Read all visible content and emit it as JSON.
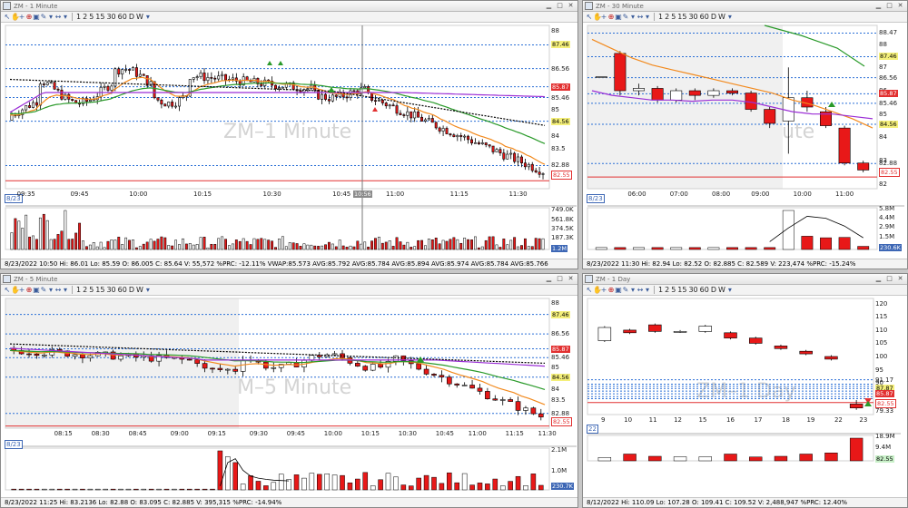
{
  "colors": {
    "up": "#ffffff",
    "down": "#e81818",
    "ema_orange": "#f28a1e",
    "ema_green": "#2a9a2a",
    "vwap_purple": "#9b2fd6",
    "sma_black": "#000000",
    "level_blue": "#2a6fd6",
    "level_red": "#e23030",
    "volume": "#e81818"
  },
  "toolbar": {
    "timeframes": [
      "1",
      "2",
      "5",
      "15",
      "30",
      "60",
      "D",
      "W"
    ],
    "icons": [
      "cursor-icon",
      "hand-icon",
      "crosshair-icon",
      "zoom-icon",
      "pencil-icon",
      "arrows-icon"
    ]
  },
  "panels": [
    {
      "id": "p1",
      "title": "ZM - 1 Minute",
      "watermark": "ZM–1 Minute",
      "date_tag": "8/23",
      "y_labels": [
        "88",
        "87.46",
        "86.56",
        "85.87",
        "85.46",
        "85",
        "84.56",
        "84",
        "83.5",
        "82.88",
        "82.55"
      ],
      "x_labels": [
        "09:35",
        "09:45",
        "10:00",
        "10:15",
        "10:30",
        "10:45",
        "11:00",
        "11:15",
        "11:30"
      ],
      "cursor_time": "10:56",
      "volume_labels": [
        "749.0K",
        "561.8K",
        "374.5K",
        "187.3K",
        "1.2M"
      ],
      "status": "8/23/2022 10:50  Hi: 86.01  Lo: 85.59  O: 86.005  C: 85.64  V: 55,572 %PRC: -12.11% VWAP:85.573 AVG:85.792 AVG:85.784 AVG:85.894 AVG:85.974 AVG:85.784 AVG:85.766"
    },
    {
      "id": "p2",
      "title": "ZM - 30 Minute",
      "watermark": "ZM–30 Minute",
      "date_tag": "8/23",
      "y_labels": [
        "88.47",
        "88",
        "87.46",
        "87",
        "86.56",
        "86",
        "85.87",
        "85.46",
        "85",
        "84.56",
        "84",
        "83",
        "82.88",
        "82.55",
        "82"
      ],
      "x_labels": [
        "06:00",
        "07:00",
        "08:00",
        "09:00",
        "10:00",
        "11:00"
      ],
      "volume_labels": [
        "5.8M",
        "4.4M",
        "2.9M",
        "1.5M",
        "230.6K"
      ],
      "status": "8/23/2022 11:30  Hi: 82.94  Lo: 82.52  O: 82.885  C: 82.589  V: 223,474 %PRC: -15.24%"
    },
    {
      "id": "p3",
      "title": "ZM - 5 Minute",
      "watermark": "ZM–5 Minute",
      "date_tag": "8/23",
      "y_labels": [
        "88",
        "87.46",
        "86.56",
        "85.87",
        "85.46",
        "85",
        "84.56",
        "84",
        "83.5",
        "82.88",
        "82.55"
      ],
      "x_labels": [
        "08:15",
        "08:30",
        "08:45",
        "09:00",
        "09:15",
        "09:30",
        "09:45",
        "10:00",
        "10:15",
        "10:30",
        "10:45",
        "11:00",
        "11:15",
        "11:30"
      ],
      "volume_labels": [
        "2.1M",
        "1.0M",
        "230.7K"
      ],
      "status": "8/23/2022 11:25  Hi: 83.2136  Lo: 82.88  O: 83.095  C: 82.885  V: 395,315 %PRC: -14.94%"
    },
    {
      "id": "p4",
      "title": "ZM - 1 Day",
      "watermark": "ZM–1 Day",
      "date_tag": "22",
      "y_labels": [
        "120",
        "115",
        "110",
        "105",
        "100",
        "95",
        "90",
        "91.17",
        "87.87",
        "85.87",
        "82.55",
        "79.33"
      ],
      "x_labels": [
        "9",
        "10",
        "11",
        "12",
        "15",
        "16",
        "17",
        "18",
        "19",
        "22",
        "23"
      ],
      "volume_labels": [
        "18.9M",
        "9.4M",
        "82.55"
      ],
      "status": "8/12/2022  Hi: 110.09  Lo: 107.28  O: 109.41  C: 109.52  V: 2,488,947 %PRC: 12.40%"
    }
  ]
}
